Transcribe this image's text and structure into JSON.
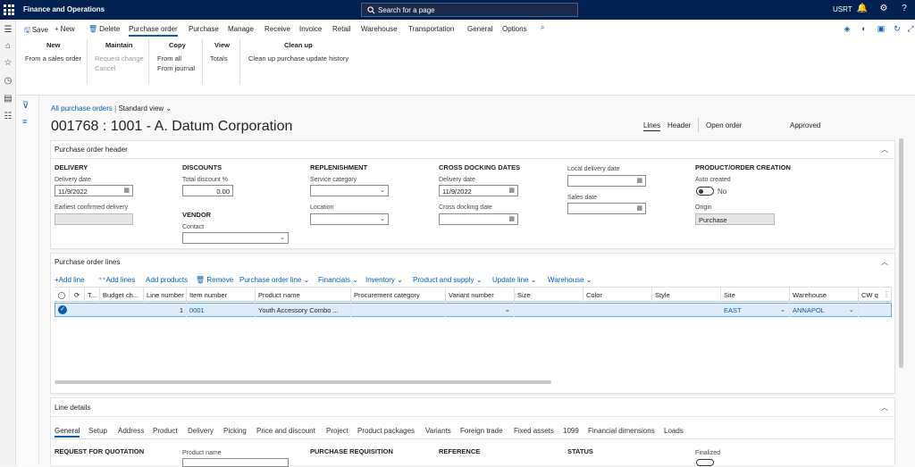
{
  "app": {
    "title": "Finance and Operations",
    "search_placeholder": "Search for a page",
    "company": "USRT"
  },
  "toolbar": {
    "save": "Save",
    "new": "New",
    "delete": "Delete",
    "tabs": [
      "Purchase order",
      "Purchase",
      "Manage",
      "Receive",
      "Invoice",
      "Retail",
      "Warehouse",
      "Transportation",
      "General",
      "Options"
    ]
  },
  "action_groups": {
    "new": {
      "title": "New",
      "items": [
        "From a sales order"
      ]
    },
    "maintain": {
      "title": "Maintain",
      "items": [
        "Request change",
        "Cancel"
      ]
    },
    "copy": {
      "title": "Copy",
      "items": [
        "From all",
        "From journal"
      ]
    },
    "view": {
      "title": "View",
      "items": [
        "Totals"
      ]
    },
    "cleanup": {
      "title": "Clean up",
      "items": [
        "Clean up purchase update history"
      ]
    }
  },
  "breadcrumb": {
    "link": "All purchase orders",
    "view": "Standard view"
  },
  "page": {
    "title": "001768 : 1001 - A. Datum Corporation",
    "lines": "Lines",
    "header": "Header",
    "status1": "Open order",
    "status2": "Approved"
  },
  "po_header": {
    "title": "Purchase order header",
    "delivery": {
      "heading": "DELIVERY",
      "date_label": "Delivery date",
      "date_value": "11/9/2022",
      "confirmed_label": "Earliest confirmed delivery"
    },
    "discounts": {
      "heading": "DISCOUNTS",
      "total_label": "Total discount %",
      "total_value": "0.00"
    },
    "vendor": {
      "heading": "VENDOR",
      "contact_label": "Contact"
    },
    "replenishment": {
      "heading": "REPLENISHMENT",
      "service_label": "Service category",
      "location_label": "Location"
    },
    "crossdock": {
      "heading": "CROSS DOCKING DATES",
      "delivery_label": "Delivery date",
      "delivery_value": "11/9/2022",
      "crossdock_label": "Cross docking date"
    },
    "local": {
      "local_label": "Local delivery date",
      "sales_label": "Sales date"
    },
    "product": {
      "heading": "PRODUCT/ORDER CREATION",
      "auto_label": "Auto created",
      "auto_value": "No",
      "origin_label": "Origin",
      "origin_value": "Purchase"
    }
  },
  "po_lines": {
    "title": "Purchase order lines",
    "actions": [
      "Add line",
      "Add lines",
      "Add products",
      "Remove",
      "Purchase order line",
      "Financials",
      "Inventory",
      "Product and supply",
      "Update line",
      "Warehouse"
    ],
    "columns": [
      "T...",
      "Budget ch...",
      "Line number",
      "Item number",
      "Product name",
      "Procurement category",
      "Variant number",
      "Size",
      "Color",
      "Style",
      "Site",
      "Warehouse",
      "CW q"
    ],
    "row": {
      "line_number": "1",
      "item_number": "0001",
      "product_name": "Youth Accessory Combo ...",
      "site": "EAST",
      "warehouse": "ANNAPOL"
    }
  },
  "line_details": {
    "title": "Line details",
    "tabs": [
      "General",
      "Setup",
      "Address",
      "Product",
      "Delivery",
      "Picking",
      "Price and discount",
      "Project",
      "Product packages",
      "Variants",
      "Foreign trade",
      "Fixed assets",
      "1099",
      "Financial dimensions",
      "Loads"
    ],
    "headings": {
      "rfq": "REQUEST FOR QUOTATION",
      "product_name": "Product name",
      "purch_req": "PURCHASE REQUISITION",
      "reference": "REFERENCE",
      "status": "STATUS",
      "finalized": "Finalized"
    }
  },
  "colors": {
    "nav": "#002050",
    "accent": "#0b5cad",
    "selected_row": "#deecf9"
  }
}
